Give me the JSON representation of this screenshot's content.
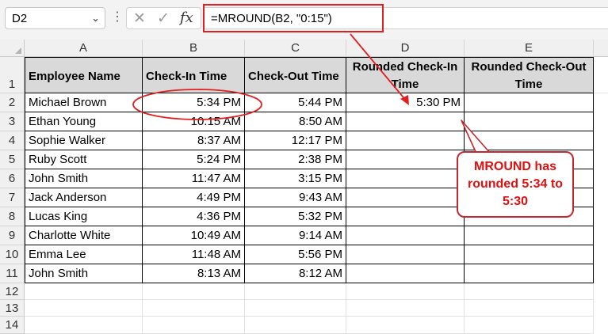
{
  "formula_bar": {
    "name_box": "D2",
    "chevron": "⌄",
    "kebab": "⋮",
    "cancel_icon": "✕",
    "enter_icon": "✓",
    "fx_label": "fx",
    "formula": "=MROUND(B2, \"0:15\")"
  },
  "columns": [
    "A",
    "B",
    "C",
    "D",
    "E"
  ],
  "rows": [
    "1",
    "2",
    "3",
    "4",
    "5",
    "6",
    "7",
    "8",
    "9",
    "10",
    "11",
    "12",
    "13",
    "14"
  ],
  "headers": {
    "a": "Employee Name",
    "b": "Check-In Time",
    "c": "Check-Out Time",
    "d": "Rounded Check-In Time",
    "e": "Rounded Check-Out Time"
  },
  "table": [
    {
      "name": "Michael Brown",
      "check_in": "5:34 PM",
      "check_out": "5:44 PM",
      "rounded_in": "5:30 PM",
      "rounded_out": ""
    },
    {
      "name": "Ethan Young",
      "check_in": "10:15 AM",
      "check_out": "8:50 AM",
      "rounded_in": "",
      "rounded_out": ""
    },
    {
      "name": "Sophie Walker",
      "check_in": "8:37 AM",
      "check_out": "12:17 PM",
      "rounded_in": "",
      "rounded_out": ""
    },
    {
      "name": "Ruby Scott",
      "check_in": "5:24 PM",
      "check_out": "2:38 PM",
      "rounded_in": "",
      "rounded_out": ""
    },
    {
      "name": "John Smith",
      "check_in": "11:47 AM",
      "check_out": "3:15 PM",
      "rounded_in": "",
      "rounded_out": ""
    },
    {
      "name": "Jack Anderson",
      "check_in": "4:49 PM",
      "check_out": "9:43 AM",
      "rounded_in": "",
      "rounded_out": ""
    },
    {
      "name": "Lucas King",
      "check_in": "4:36 PM",
      "check_out": "5:32 PM",
      "rounded_in": "",
      "rounded_out": ""
    },
    {
      "name": "Charlotte White",
      "check_in": "10:49 AM",
      "check_out": "9:14 AM",
      "rounded_in": "",
      "rounded_out": ""
    },
    {
      "name": "Emma Lee",
      "check_in": "11:48 AM",
      "check_out": "5:56 PM",
      "rounded_in": "",
      "rounded_out": ""
    },
    {
      "name": "John Smith",
      "check_in": "8:13 AM",
      "check_out": "8:12 AM",
      "rounded_in": "",
      "rounded_out": ""
    }
  ],
  "callout": {
    "line1": "MROUND has",
    "line2": "rounded 5:34 to",
    "line3": "5:30"
  },
  "colors": {
    "annotation_red": "#e02020",
    "header_fill": "#d9d9d9"
  }
}
